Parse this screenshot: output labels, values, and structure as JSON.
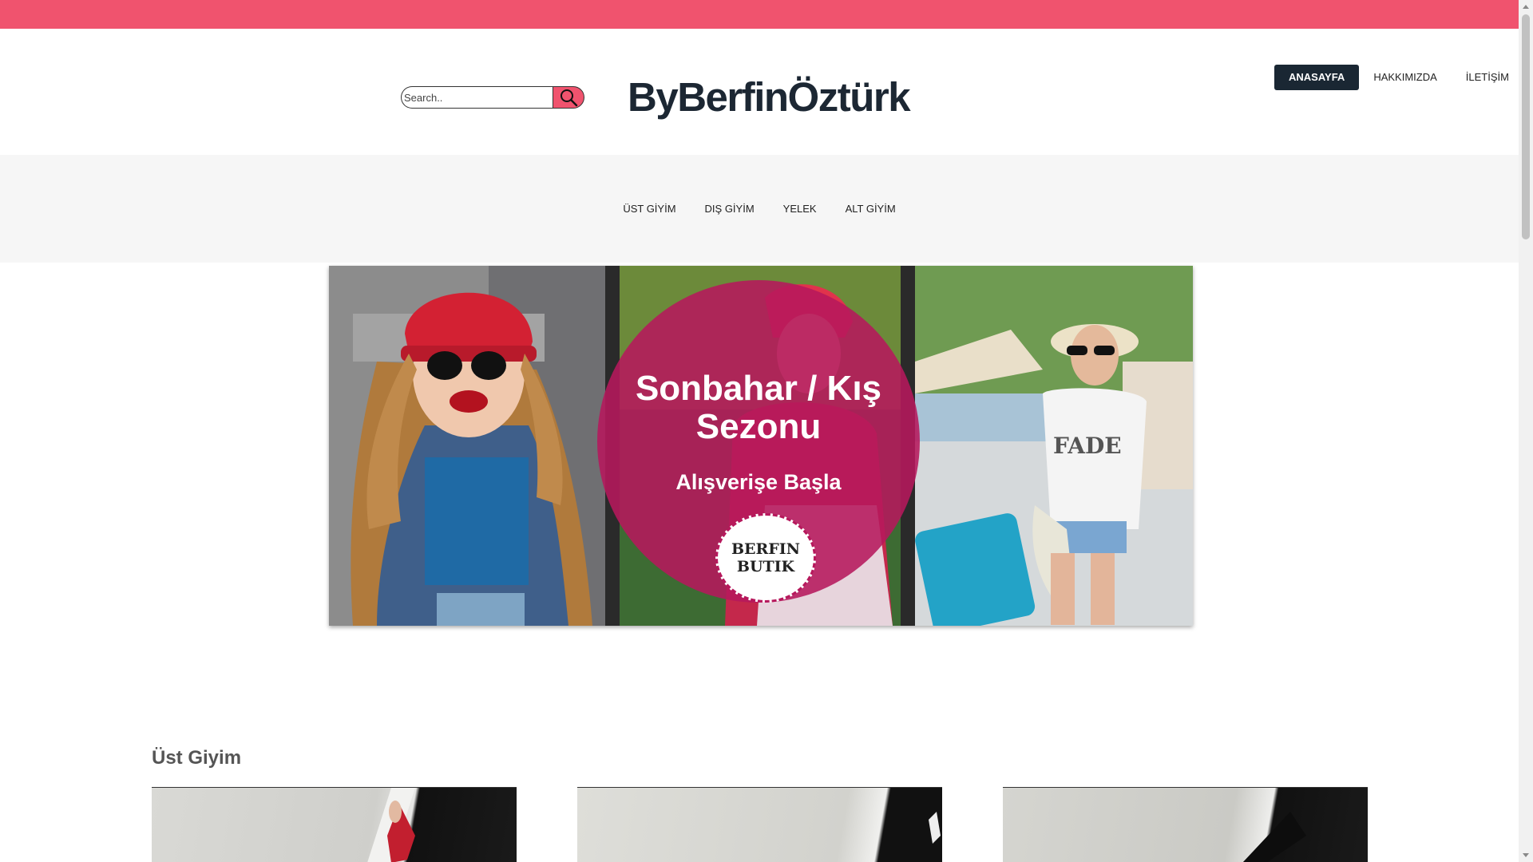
{
  "colors": {
    "accent": "#f0536e",
    "nav_dark": "#1a2733",
    "brand_text": "#1c2733",
    "category_bar": "#f6f6f6"
  },
  "header": {
    "search_placeholder": "Search..",
    "search_icon": "search-icon",
    "brand": "ByBerfinÖztürk",
    "nav": [
      {
        "label": "ANASAYFA",
        "active": true
      },
      {
        "label": "HAKKIMIZDA",
        "active": false
      },
      {
        "label": "İLETİŞİM",
        "active": false
      }
    ]
  },
  "categories": [
    "ÜST GİYİM",
    "DIŞ GİYİM",
    "YELEK",
    "ALT GİYİM"
  ],
  "banner": {
    "title_line1": "Sonbahar / Kış",
    "title_line2": "Sezonu",
    "subtitle": "Alışverişe Başla",
    "badge_line1": "BERFIN",
    "badge_line2": "BUTIK",
    "tshirt_text": "FADE"
  },
  "section": {
    "title": "Üst Giyim"
  }
}
